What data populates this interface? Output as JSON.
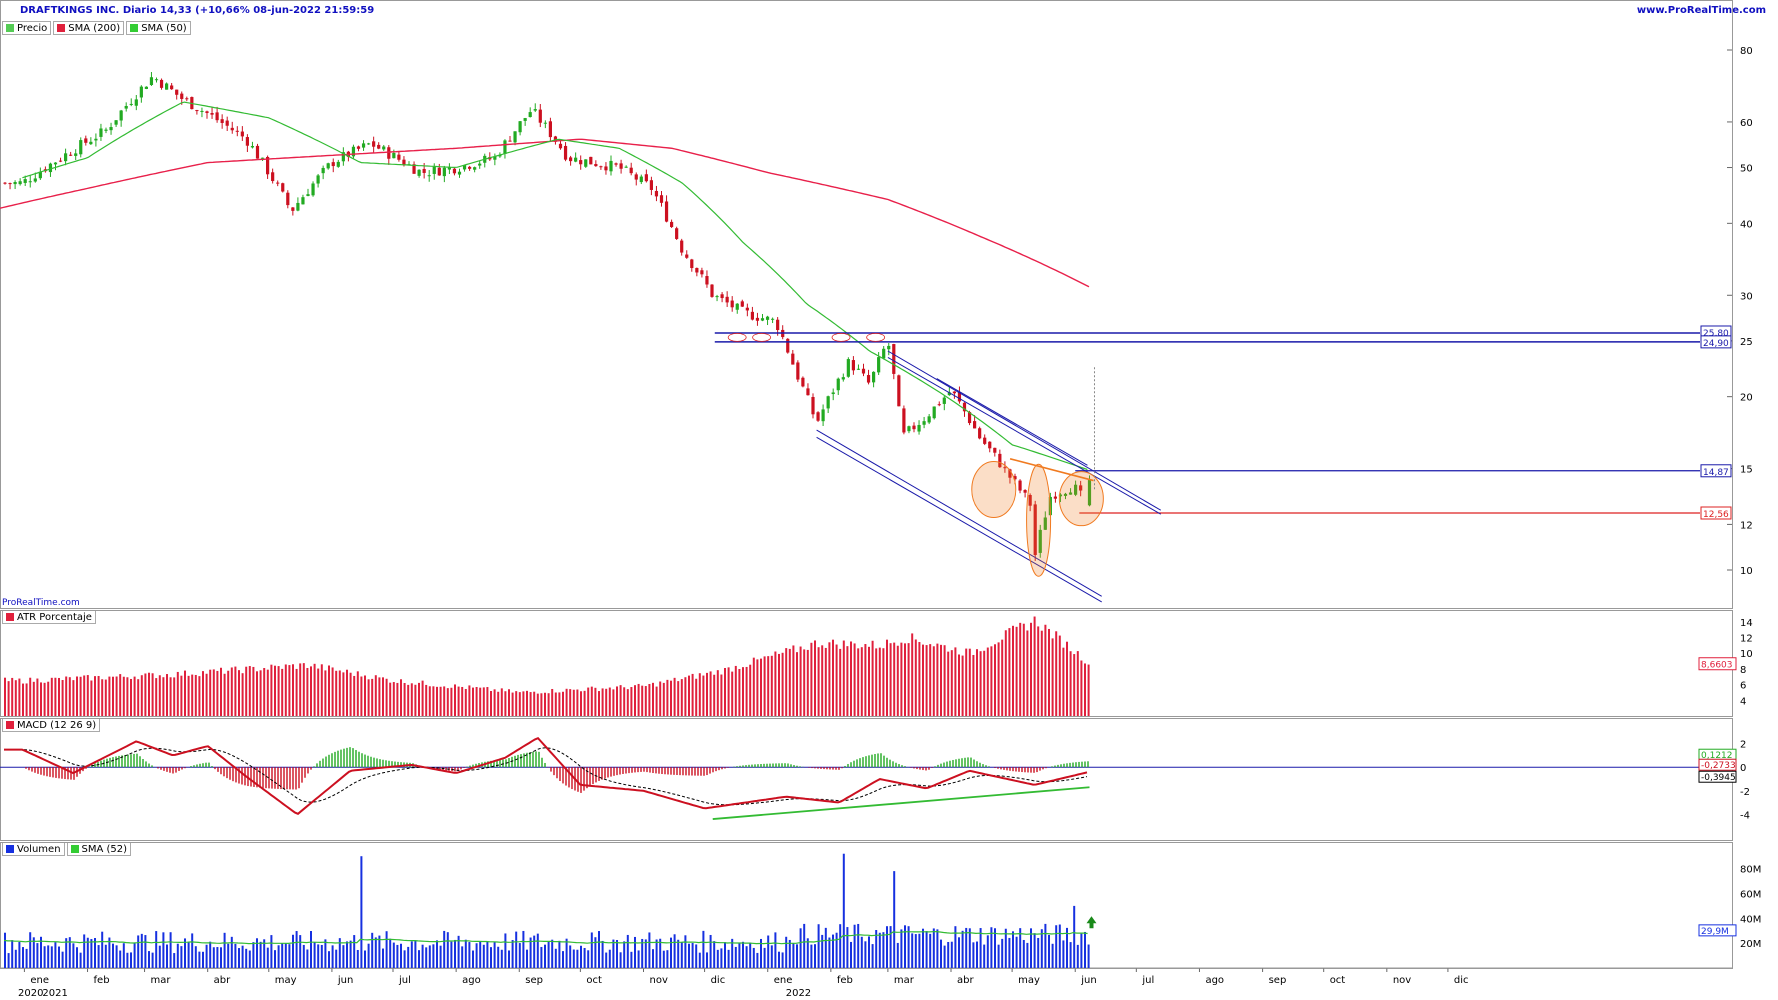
{
  "header": {
    "title": "DRAFTKINGS INC. Diario 14,33 (+10,66% 08-jun-2022 21:59:59",
    "site": "www.ProRealTime.com",
    "watermark": "ProRealTime.com"
  },
  "legends": {
    "price": [
      "Precio",
      "SMA (200)",
      "SMA (50)"
    ],
    "atr": "ATR Porcentaje",
    "macd": "MACD (12 26 9)",
    "volume": [
      "Volumen",
      "SMA (52)"
    ]
  },
  "colors": {
    "up": "#22aa22",
    "down": "#cc1020",
    "sma200": "#e8204a",
    "sma50": "#33bb33",
    "levels": "#1a1aaa",
    "support": "#dd2020",
    "pattern": "#f07a20",
    "volume": "#1630e0",
    "atr": "#e0203c"
  },
  "chart_data": [
    {
      "panel": "price",
      "type": "candlestick",
      "scale": "log",
      "ylim": [
        9,
        90
      ],
      "yticks": [
        "80",
        "60",
        "50",
        "40",
        "30",
        "25",
        "20",
        "15",
        "12",
        "10"
      ],
      "x_labels": [
        "ene",
        "feb",
        "mar",
        "abr",
        "may",
        "jun",
        "jul",
        "ago",
        "sep",
        "oct",
        "nov",
        "dic",
        "ene",
        "feb",
        "mar",
        "abr",
        "may",
        "jun",
        "jul",
        "ago",
        "sep",
        "oct",
        "nov",
        "dic"
      ],
      "year_labels": [
        "2020",
        "2021",
        "2022"
      ],
      "close_path": [
        [
          "2020-12-31",
          47
        ],
        [
          "2021-01-15",
          51
        ],
        [
          "2021-02-10",
          58
        ],
        [
          "2021-03-05",
          72
        ],
        [
          "2021-03-19",
          66
        ],
        [
          "2021-04-01",
          62
        ],
        [
          "2021-04-20",
          56
        ],
        [
          "2021-05-12",
          42
        ],
        [
          "2021-06-01",
          51
        ],
        [
          "2021-06-20",
          55
        ],
        [
          "2021-07-15",
          49
        ],
        [
          "2021-08-01",
          50
        ],
        [
          "2021-08-20",
          52
        ],
        [
          "2021-09-07",
          63
        ],
        [
          "2021-09-25",
          52
        ],
        [
          "2021-10-20",
          50
        ],
        [
          "2021-11-05",
          46
        ],
        [
          "2021-11-20",
          36
        ],
        [
          "2021-12-05",
          30
        ],
        [
          "2021-12-20",
          28
        ],
        [
          "2022-01-05",
          27
        ],
        [
          "2022-01-15",
          22
        ],
        [
          "2022-01-25",
          18
        ],
        [
          "2022-02-10",
          23
        ],
        [
          "2022-02-20",
          21
        ],
        [
          "2022-03-01",
          25
        ],
        [
          "2022-03-08",
          17
        ],
        [
          "2022-03-20",
          18.5
        ],
        [
          "2022-04-01",
          20.5
        ],
        [
          "2022-04-15",
          17
        ],
        [
          "2022-04-30",
          14.5
        ],
        [
          "2022-05-10",
          13
        ],
        [
          "2022-05-12",
          10.5
        ],
        [
          "2022-05-20",
          13.5
        ],
        [
          "2022-05-31",
          14
        ],
        [
          "2022-06-07",
          12.95
        ],
        [
          "2022-06-08",
          14.33
        ]
      ],
      "sma200": [
        [
          "2020-12-20",
          42.5
        ],
        [
          "2021-02-01",
          46
        ],
        [
          "2021-04-01",
          51
        ],
        [
          "2021-06-01",
          52.5
        ],
        [
          "2021-08-01",
          54
        ],
        [
          "2021-10-01",
          56
        ],
        [
          "2021-11-15",
          54
        ],
        [
          "2022-01-01",
          49
        ],
        [
          "2022-03-01",
          44
        ],
        [
          "2022-04-15",
          38
        ],
        [
          "2022-06-08",
          31
        ]
      ],
      "sma50": [
        [
          "2020-12-31",
          48
        ],
        [
          "2021-02-01",
          52
        ],
        [
          "2021-03-20",
          65
        ],
        [
          "2021-05-01",
          61
        ],
        [
          "2021-06-15",
          51
        ],
        [
          "2021-08-01",
          50
        ],
        [
          "2021-09-20",
          56
        ],
        [
          "2021-10-20",
          54
        ],
        [
          "2021-11-20",
          47
        ],
        [
          "2021-12-20",
          37
        ],
        [
          "2022-01-20",
          29
        ],
        [
          "2022-02-20",
          24
        ],
        [
          "2022-03-25",
          20.5
        ],
        [
          "2022-05-01",
          16.5
        ],
        [
          "2022-06-08",
          14.9
        ]
      ],
      "levels": [
        {
          "label": "25,80",
          "value": 25.8,
          "color": "levels"
        },
        {
          "label": "24,90",
          "value": 24.9,
          "color": "levels"
        },
        {
          "label": "14,87",
          "value": 14.87,
          "color": "levels"
        },
        {
          "label": "12,56",
          "value": 12.56,
          "color": "support"
        }
      ]
    },
    {
      "panel": "atr",
      "type": "bar",
      "ylim": [
        2,
        15
      ],
      "yticks": [
        "14",
        "12",
        "10",
        "8",
        "6",
        "4"
      ],
      "last_value": "8,6603",
      "path": [
        [
          "2020-12-31",
          6.5
        ],
        [
          "2021-03-15",
          7.3
        ],
        [
          "2021-05-20",
          8.5
        ],
        [
          "2021-07-01",
          6.5
        ],
        [
          "2021-09-01",
          5.0
        ],
        [
          "2021-11-01",
          5.8
        ],
        [
          "2021-12-10",
          7.8
        ],
        [
          "2022-01-25",
          11.3
        ],
        [
          "2022-02-25",
          11.0
        ],
        [
          "2022-03-10",
          12.0
        ],
        [
          "2022-04-10",
          10.0
        ],
        [
          "2022-05-12",
          14.2
        ],
        [
          "2022-06-08",
          8.66
        ]
      ]
    },
    {
      "panel": "macd",
      "type": "line",
      "ylim": [
        -5.5,
        3.5
      ],
      "yticks": [
        "2",
        "0",
        "-2",
        "-4"
      ],
      "last_values": {
        "macd": "-0,3945",
        "signal": "-0,2733",
        "histogram": "0,1212"
      },
      "macd": [
        [
          "2020-12-31",
          1.5
        ],
        [
          "2021-01-25",
          -0.5
        ],
        [
          "2021-02-25",
          2.2
        ],
        [
          "2021-03-15",
          1.0
        ],
        [
          "2021-04-01",
          1.8
        ],
        [
          "2021-04-20",
          -0.8
        ],
        [
          "2021-05-15",
          -4.0
        ],
        [
          "2021-06-10",
          -0.3
        ],
        [
          "2021-07-10",
          0.2
        ],
        [
          "2021-08-01",
          -0.5
        ],
        [
          "2021-08-25",
          0.8
        ],
        [
          "2021-09-10",
          2.5
        ],
        [
          "2021-10-01",
          -1.5
        ],
        [
          "2021-11-01",
          -2.0
        ],
        [
          "2021-12-01",
          -3.5
        ],
        [
          "2022-01-10",
          -2.5
        ],
        [
          "2022-02-05",
          -3.0
        ],
        [
          "2022-02-25",
          -1.0
        ],
        [
          "2022-03-20",
          -1.8
        ],
        [
          "2022-04-10",
          -0.3
        ],
        [
          "2022-05-12",
          -1.5
        ],
        [
          "2022-06-08",
          -0.39
        ]
      ],
      "divergence_line": [
        [
          "2021-12-05",
          -4.4
        ],
        [
          "2022-06-08",
          -1.7
        ]
      ]
    },
    {
      "panel": "volume",
      "type": "bar",
      "ylim": [
        0,
        95
      ],
      "yticks": [
        "80M",
        "60M",
        "40M",
        "20M"
      ],
      "last_value": "29,9M",
      "spikes": [
        [
          "2021-06-15",
          90
        ],
        [
          "2022-02-07",
          92
        ],
        [
          "2022-03-04",
          78
        ],
        [
          "2022-05-31",
          50
        ]
      ]
    }
  ]
}
